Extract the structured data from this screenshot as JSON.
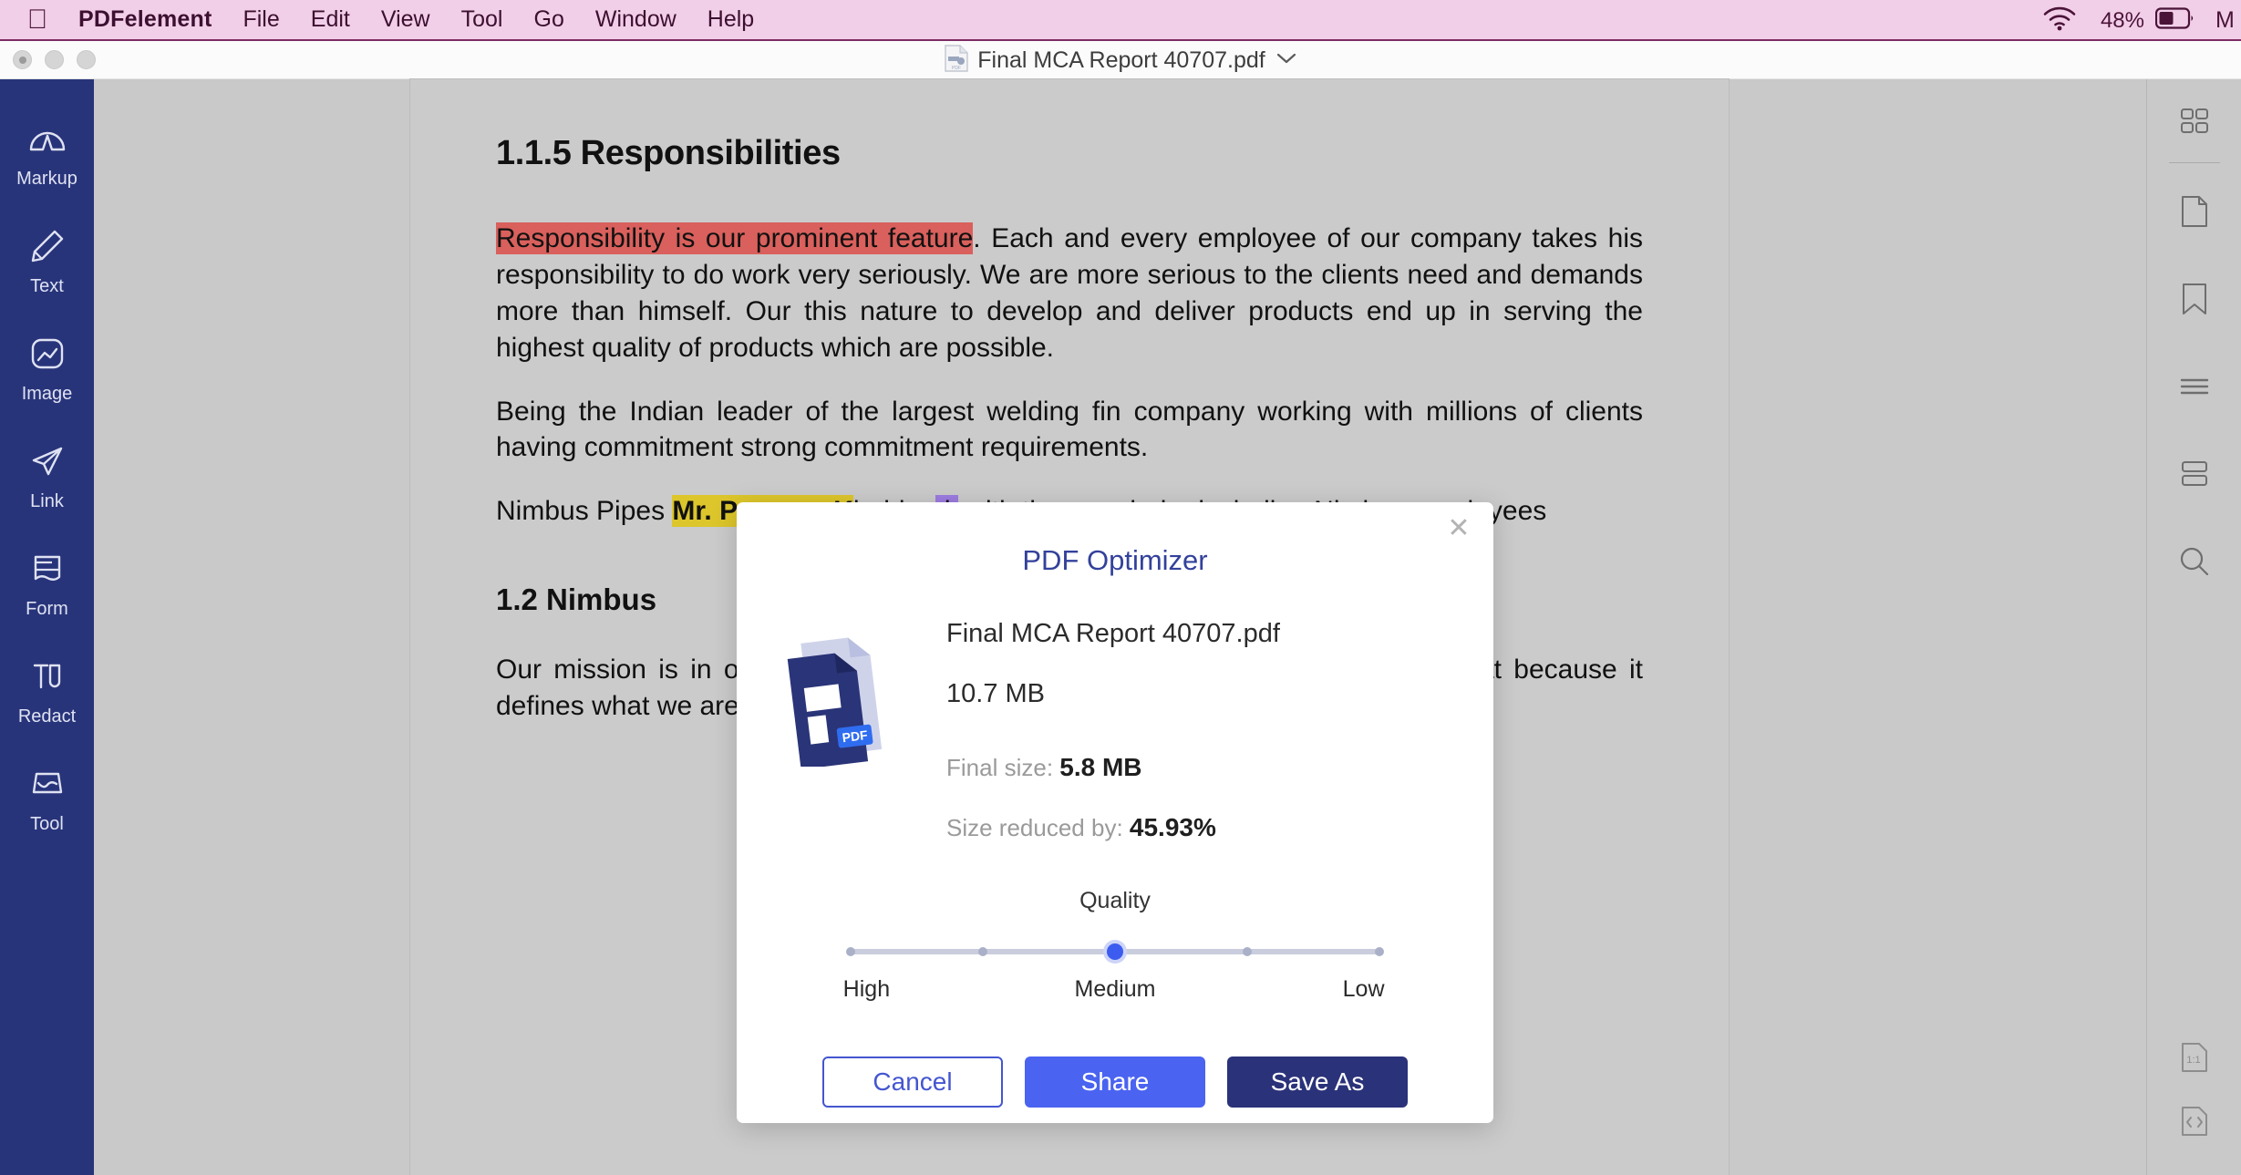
{
  "menubar": {
    "apple_icon": "apple-logo",
    "app_name": "PDFelement",
    "items": [
      "File",
      "Edit",
      "View",
      "Tool",
      "Go",
      "Window",
      "Help"
    ],
    "wifi_icon": "wifi-icon",
    "battery_percent": "48%",
    "battery_icon": "battery-icon",
    "trailing_text": "M",
    "bg_color": "#f2cfe8",
    "text_color": "#3c1030"
  },
  "titlebar": {
    "doc_icon": "pdf-document-icon",
    "title": "Final MCA Report 40707.pdf",
    "chevron_icon": "chevron-down-icon"
  },
  "left_sidebar": {
    "bg_color": "#28347a",
    "items": [
      {
        "label": "Markup",
        "icon": "markup-icon"
      },
      {
        "label": "Text",
        "icon": "pencil-icon"
      },
      {
        "label": "Image",
        "icon": "image-icon"
      },
      {
        "label": "Link",
        "icon": "link-send-icon"
      },
      {
        "label": "Form",
        "icon": "form-icon"
      },
      {
        "label": "Redact",
        "icon": "redact-icon"
      },
      {
        "label": "Tool",
        "icon": "toolbox-icon"
      }
    ]
  },
  "right_sidebar": {
    "items": [
      {
        "icon": "grid-thumbnails-icon"
      },
      {
        "icon": "page-icon"
      },
      {
        "icon": "bookmark-icon"
      },
      {
        "icon": "list-lines-icon"
      },
      {
        "icon": "stacked-panels-icon"
      },
      {
        "icon": "search-icon"
      }
    ],
    "bottom_items": [
      {
        "icon": "actual-size-icon",
        "label": "1:1"
      },
      {
        "icon": "code-page-icon"
      }
    ]
  },
  "document": {
    "heading": "1.1.5 Responsibilities",
    "p1_highlight": "Responsibility is our prominent feature",
    "p1_rest": ". Each and every employee of our company takes his responsibility to do work very seriously. We are more serious to the clients need and demands more than himself. Our this nature to develop and deliver products end up in serving the highest quality of products which are possible.",
    "p2": "Being the Indian leader of the largest welding fin company working with millions of clients having commitment strong commitment requirements.",
    "p3_a": "Nimbus Pipes ",
    "p3_b": "Mr. Praveen K",
    "p3_c": "holder.",
    "p3_d": "d.",
    "p3_e": " with the remainder including Nimbus employees",
    "heading2": "1.2 Nimbus",
    "p4": "Our mission is in order to pursue that mission we follow strictly no matter what because it defines what we are."
  },
  "modal": {
    "title": "PDF Optimizer",
    "close_icon": "close-icon",
    "file_icon": "pdf-file-icon",
    "file_icon_badge": "PDF",
    "file_name": "Final MCA Report 40707.pdf",
    "original_size": "10.7 MB",
    "final_size_label": "Final size:",
    "final_size_value": "5.8 MB",
    "reduced_label": "Size reduced by:",
    "reduced_value": "45.93%",
    "quality_label": "Quality",
    "quality_ticks": [
      0,
      25,
      50,
      75,
      100
    ],
    "quality_value": 50,
    "quality_scale": [
      "High",
      "Medium",
      "Low"
    ],
    "buttons": {
      "cancel": "Cancel",
      "share": "Share",
      "save_as": "Save As"
    },
    "accent_color": "#4a63f0",
    "primary_color": "#2a3279",
    "title_color": "#33419b"
  }
}
